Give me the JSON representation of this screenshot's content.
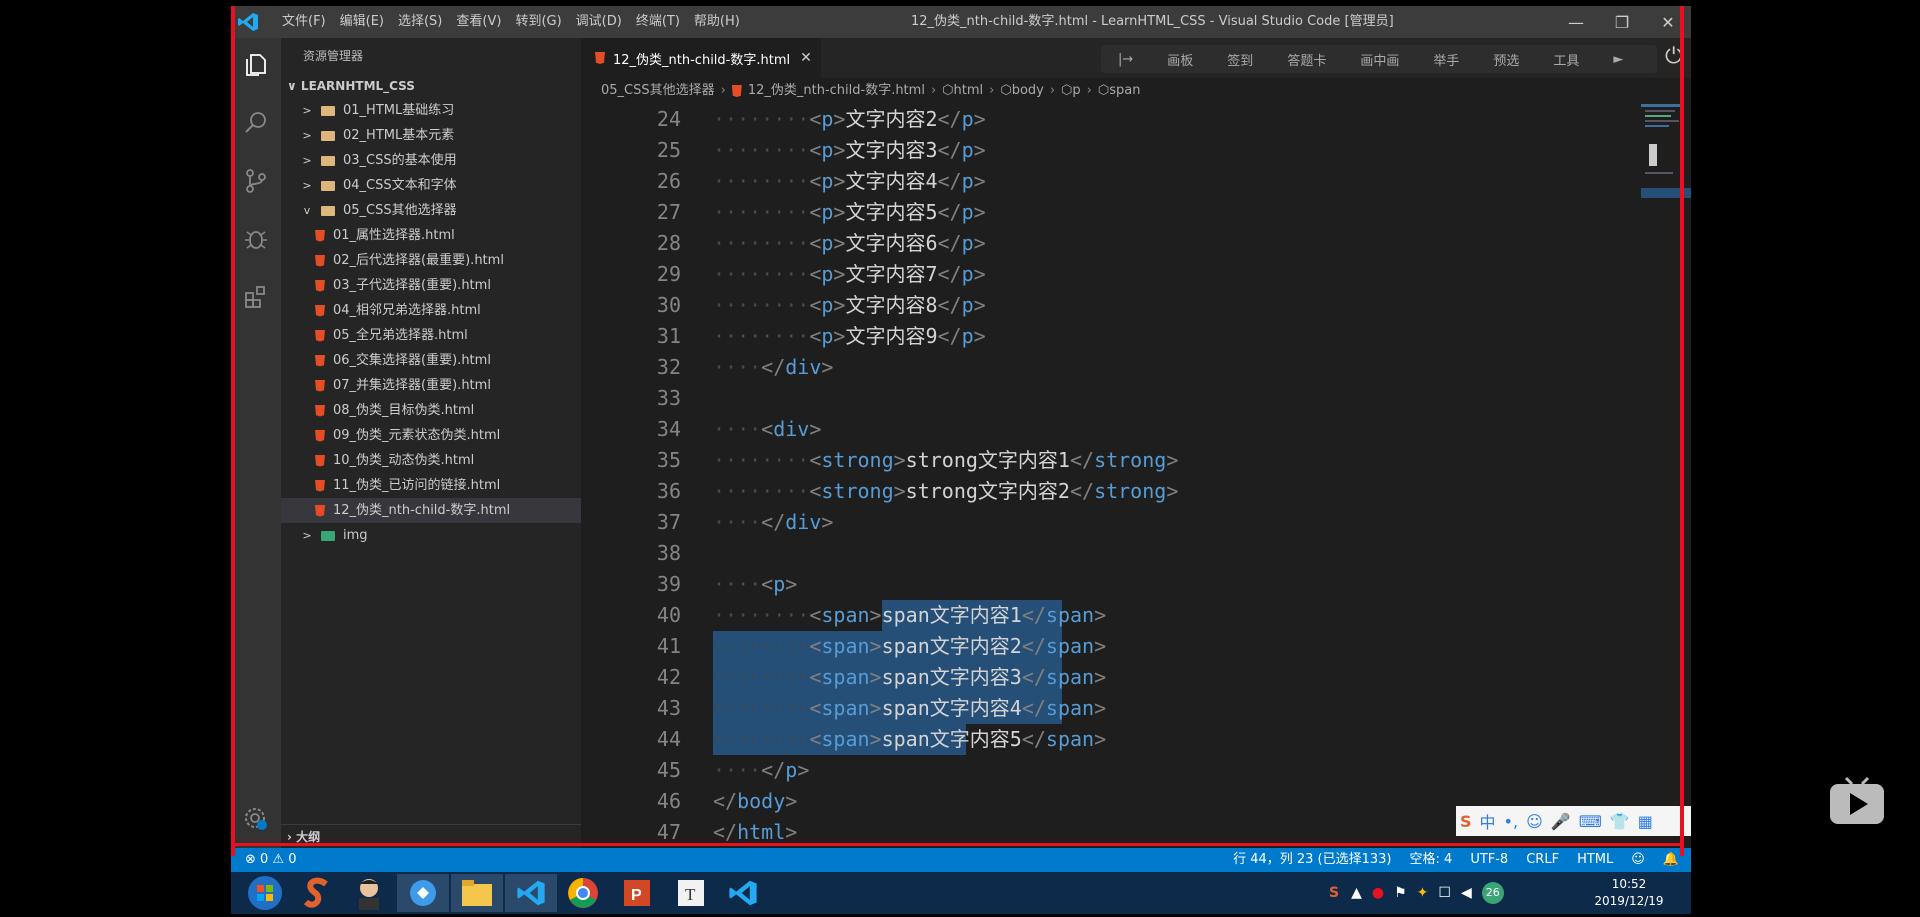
{
  "menu": [
    "文件(F)",
    "编辑(E)",
    "选择(S)",
    "查看(V)",
    "转到(G)",
    "调试(D)",
    "终端(T)",
    "帮助(H)"
  ],
  "window_title": "12_伪类_nth-child-数字.html - LearnHTML_CSS - Visual Studio Code [管理员]",
  "window_controls": {
    "minimize": "—",
    "restore": "❐",
    "close": "✕"
  },
  "sidebar": {
    "title": "资源管理器",
    "workspace": "LEARNHTML_CSS",
    "folders": [
      {
        "chevron": ">",
        "label": "01_HTML基础练习"
      },
      {
        "chevron": ">",
        "label": "02_HTML基本元素"
      },
      {
        "chevron": ">",
        "label": "03_CSS的基本使用"
      },
      {
        "chevron": ">",
        "label": "04_CSS文本和字体"
      },
      {
        "chevron": "v",
        "label": "05_CSS其他选择器"
      }
    ],
    "files": [
      "01_属性选择器.html",
      "02_后代选择器(最重要).html",
      "03_子代选择器(重要).html",
      "04_相邻兄弟选择器.html",
      "05_全兄弟选择器.html",
      "06_交集选择器(重要).html",
      "07_并集选择器(重要).html",
      "08_伪类_目标伪类.html",
      "09_伪类_元素状态伪类.html",
      "10_伪类_动态伪类.html",
      "11_伪类_已访问的链接.html",
      "12_伪类_nth-child-数字.html"
    ],
    "img_folder": {
      "chevron": ">",
      "label": "img"
    },
    "outline": "大纲"
  },
  "tab": {
    "label": "12_伪类_nth-child-数字.html",
    "close": "✕"
  },
  "toolbar": [
    "|→",
    "画板",
    "签到",
    "答题卡",
    "画中画",
    "举手",
    "预选",
    "工具",
    "►"
  ],
  "breadcrumb": [
    "05_CSS其他选择器",
    "12_伪类_nth-child-数字.html",
    "html",
    "body",
    "p",
    "span"
  ],
  "code": [
    {
      "n": "24",
      "indent": 2,
      "open": "p",
      "text": "文字内容2",
      "close": "p"
    },
    {
      "n": "25",
      "indent": 2,
      "open": "p",
      "text": "文字内容3",
      "close": "p"
    },
    {
      "n": "26",
      "indent": 2,
      "open": "p",
      "text": "文字内容4",
      "close": "p"
    },
    {
      "n": "27",
      "indent": 2,
      "open": "p",
      "text": "文字内容5",
      "close": "p"
    },
    {
      "n": "28",
      "indent": 2,
      "open": "p",
      "text": "文字内容6",
      "close": "p"
    },
    {
      "n": "29",
      "indent": 2,
      "open": "p",
      "text": "文字内容7",
      "close": "p"
    },
    {
      "n": "30",
      "indent": 2,
      "open": "p",
      "text": "文字内容8",
      "close": "p"
    },
    {
      "n": "31",
      "indent": 2,
      "open": "p",
      "text": "文字内容9",
      "close": "p"
    },
    {
      "n": "32",
      "indent": 1,
      "close": "div"
    },
    {
      "n": "33",
      "indent": 0
    },
    {
      "n": "34",
      "indent": 1,
      "open": "div"
    },
    {
      "n": "35",
      "indent": 2,
      "open": "strong",
      "text": "strong文字内容1",
      "close": "strong"
    },
    {
      "n": "36",
      "indent": 2,
      "open": "strong",
      "text": "strong文字内容2",
      "close": "strong"
    },
    {
      "n": "37",
      "indent": 1,
      "close": "div"
    },
    {
      "n": "38",
      "indent": 0
    },
    {
      "n": "39",
      "indent": 1,
      "open": "p"
    },
    {
      "n": "40",
      "indent": 2,
      "open": "span",
      "text": "span文字内容1",
      "close": "span"
    },
    {
      "n": "41",
      "indent": 2,
      "open": "span",
      "text": "span文字内容2",
      "close": "span"
    },
    {
      "n": "42",
      "indent": 2,
      "open": "span",
      "text": "span文字内容3",
      "close": "span"
    },
    {
      "n": "43",
      "indent": 2,
      "open": "span",
      "text": "span文字内容4",
      "close": "span"
    },
    {
      "n": "44",
      "indent": 2,
      "open": "span",
      "text": "span文字内容5",
      "close": "span"
    },
    {
      "n": "45",
      "indent": 1,
      "close": "p"
    },
    {
      "n": "46",
      "indent": 0,
      "close": "body"
    },
    {
      "n": "47",
      "indent": 0,
      "close": "html"
    }
  ],
  "selection": {
    "start_line": "40",
    "end_line": "44"
  },
  "ime": [
    "S",
    "中",
    "•,",
    "☺",
    "🎤",
    "⌨",
    "👕",
    "▦"
  ],
  "status": {
    "errors": "⊗ 0 ⚠ 0",
    "position": "行 44，列 23 (已选择133)",
    "spaces": "空格: 4",
    "encoding": "UTF-8",
    "eol": "CRLF",
    "language": "HTML",
    "feedback": "☺",
    "bell": "🔔"
  },
  "taskbar": {
    "tray_badge": "26",
    "time": "10:52",
    "date": "2019/12/19"
  },
  "colors": {
    "accent": "#007acc",
    "tag": "#569cd6",
    "selection": "#264f78",
    "frame": "#e81123"
  }
}
